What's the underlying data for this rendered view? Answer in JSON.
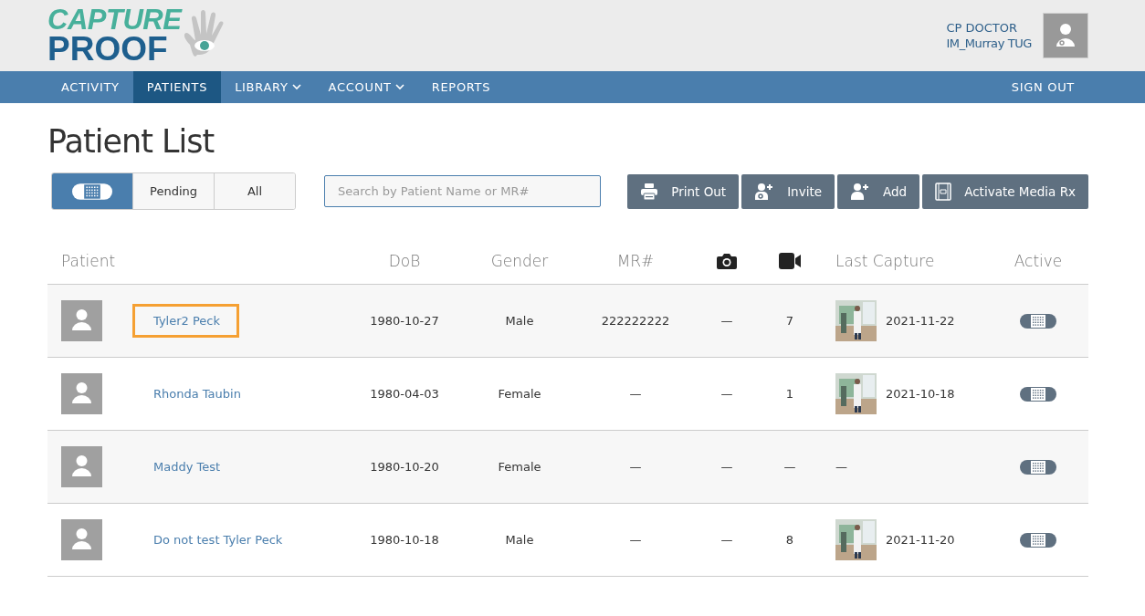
{
  "logo": {
    "line1": "CAPTURE",
    "line2": "PROOF"
  },
  "user": {
    "role": "CP DOCTOR",
    "name": "IM_Murray TUG"
  },
  "nav": [
    {
      "label": "ACTIVITY",
      "selected": false,
      "dropdown": false
    },
    {
      "label": "PATIENTS",
      "selected": true,
      "dropdown": false
    },
    {
      "label": "LIBRARY",
      "selected": false,
      "dropdown": true
    },
    {
      "label": "ACCOUNT",
      "selected": false,
      "dropdown": true
    },
    {
      "label": "REPORTS",
      "selected": false,
      "dropdown": false
    }
  ],
  "sign_out": "SIGN OUT",
  "title": "Patient List",
  "filters": [
    {
      "kind": "icon",
      "selected": true
    },
    {
      "kind": "text",
      "label": "Pending",
      "selected": false
    },
    {
      "kind": "text",
      "label": "All",
      "selected": false
    }
  ],
  "search": {
    "placeholder": "Search by Patient Name or MR#"
  },
  "actions": [
    {
      "kind": "print",
      "label": "Print Out"
    },
    {
      "kind": "invite",
      "label": "Invite"
    },
    {
      "kind": "add",
      "label": "Add"
    },
    {
      "kind": "media",
      "label": "Activate Media Rx"
    }
  ],
  "columns": [
    "Patient",
    "DoB",
    "Gender",
    "MR#",
    "Last Capture",
    "Active"
  ],
  "rows": [
    {
      "name": "Tyler2 Peck",
      "focused": true,
      "dob": "1980-10-27",
      "gender": "Male",
      "mr": "222222222",
      "photos": "—",
      "videos": "7",
      "thumbnail": true,
      "last_capture": "2021-11-22",
      "active": true
    },
    {
      "name": "Rhonda Taubin",
      "focused": false,
      "dob": "1980-04-03",
      "gender": "Female",
      "mr": "—",
      "photos": "—",
      "videos": "1",
      "thumbnail": true,
      "last_capture": "2021-10-18",
      "active": true
    },
    {
      "name": "Maddy Test",
      "focused": false,
      "dob": "1980-10-20",
      "gender": "Female",
      "mr": "—",
      "photos": "—",
      "videos": "—",
      "thumbnail": false,
      "last_capture": "—",
      "active": true
    },
    {
      "name": "Do not test Tyler Peck",
      "focused": false,
      "dob": "1980-10-18",
      "gender": "Male",
      "mr": "—",
      "photos": "—",
      "videos": "8",
      "thumbnail": true,
      "last_capture": "2021-11-20",
      "active": true
    }
  ]
}
